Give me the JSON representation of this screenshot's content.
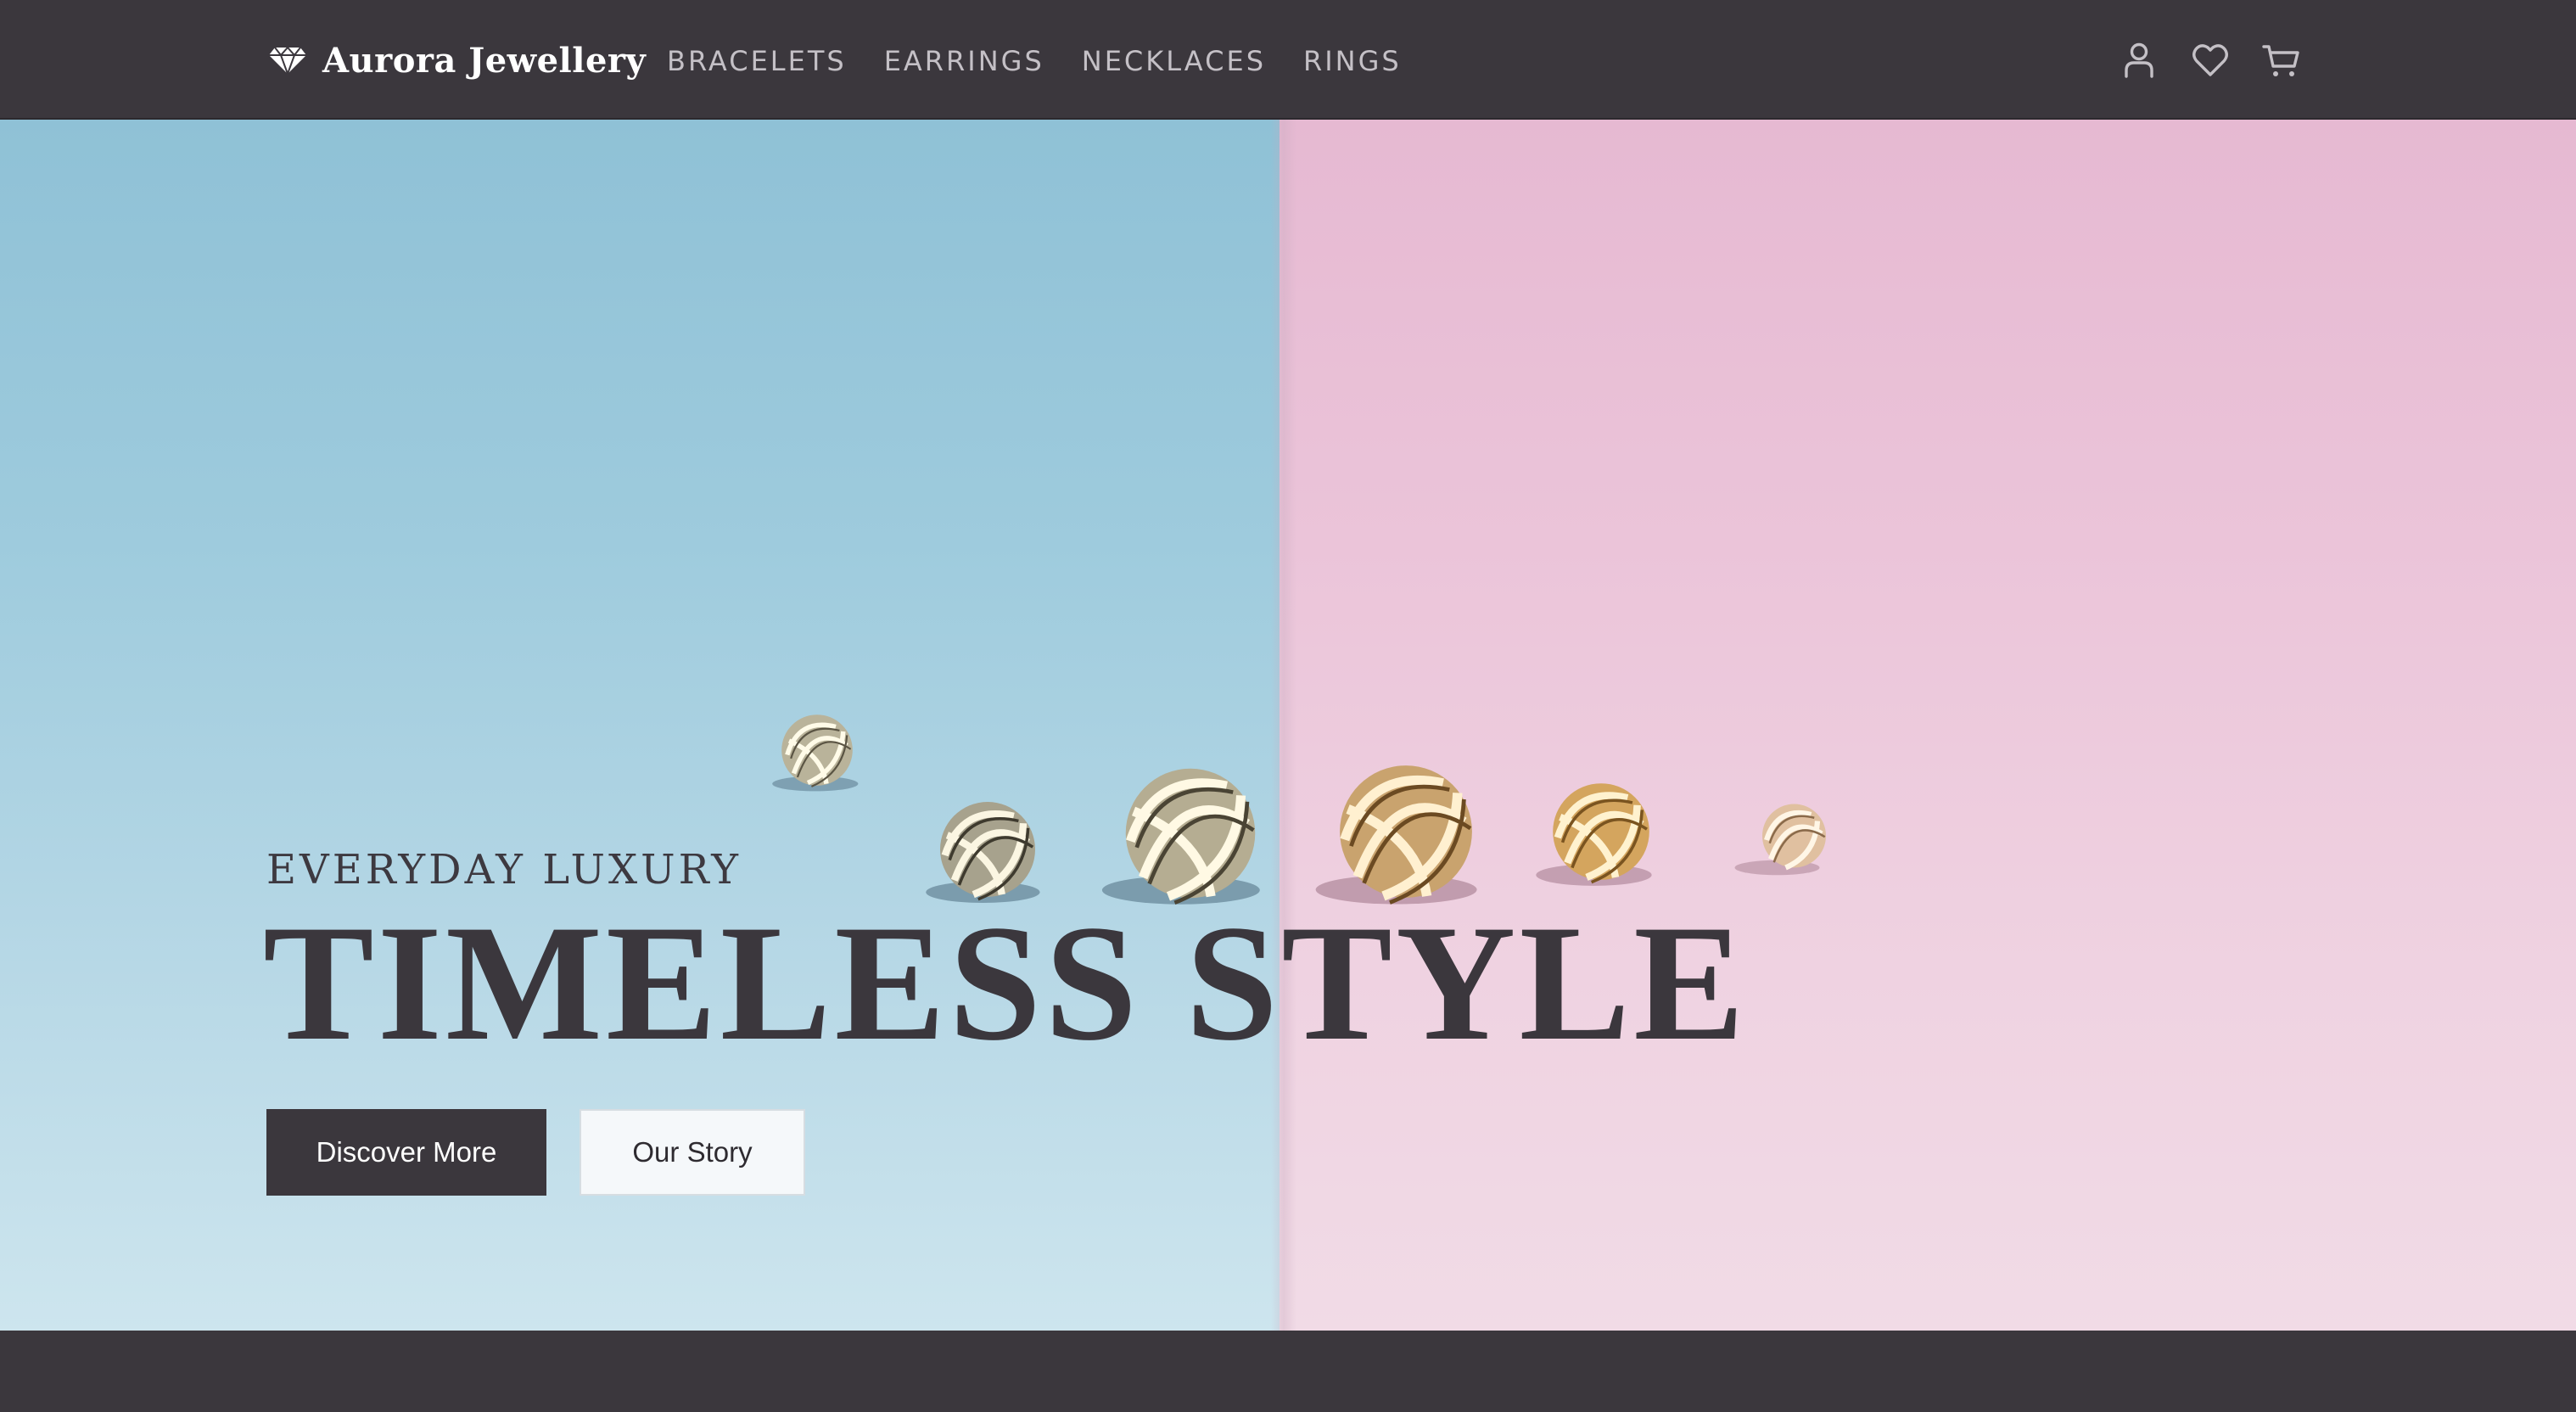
{
  "header": {
    "brand_name": "Aurora Jewellery",
    "brand_icon": "diamond-icon",
    "nav": [
      {
        "label": "BRACELETS"
      },
      {
        "label": "EARRINGS"
      },
      {
        "label": "NECKLACES"
      },
      {
        "label": "RINGS"
      }
    ],
    "icons": [
      "user-icon",
      "heart-icon",
      "cart-icon"
    ]
  },
  "hero": {
    "eyebrow": "EVERYDAY LUXURY",
    "title": "TIMELESS STYLE",
    "primary_button": "Discover More",
    "secondary_button": "Our Story",
    "image_description_colors": {
      "left_background": "#9ecbdd",
      "right_background": "#ebc4d9"
    }
  },
  "colors": {
    "nav_background": "#3b373d",
    "nav_text": "#c4c0c6",
    "primary_button": "#3b373d",
    "title_text": "#3b373d"
  }
}
